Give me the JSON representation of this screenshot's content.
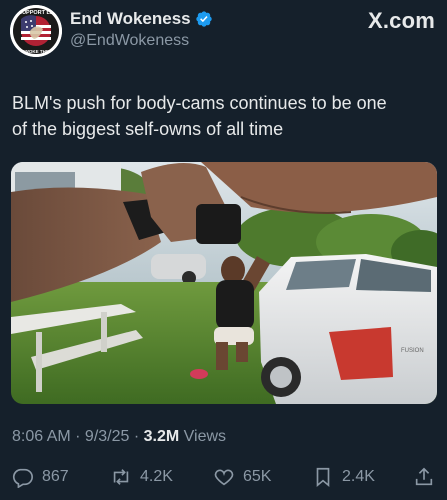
{
  "author": {
    "name": "End Wokeness",
    "handle": "@EndWokeness",
    "avatar_icon": "support-patch-avatar",
    "avatar_top_text": "SUPPORT LE",
    "avatar_bottom_text": "ENDWOKE THINGS",
    "verified_color": "#1d9bf0"
  },
  "site": {
    "brand": "X.com"
  },
  "tweet": {
    "text_line1": "BLM's push for body-cams continues to be one",
    "text_line2": "of the biggest self-owns of all time"
  },
  "media": {
    "description_icon": "bodycam-video-frame",
    "car_badge": "FUSION"
  },
  "meta": {
    "time": "8:06 AM",
    "sep": " · ",
    "date": "9/3/25",
    "views_count": "3.2M",
    "views_label": "Views"
  },
  "actions": {
    "replies": "867",
    "reposts": "4.2K",
    "likes": "65K",
    "bookmarks": "2.4K"
  },
  "colors": {
    "background": "#15202b",
    "text": "#e7e9ea",
    "secondary": "#8b98a5"
  }
}
